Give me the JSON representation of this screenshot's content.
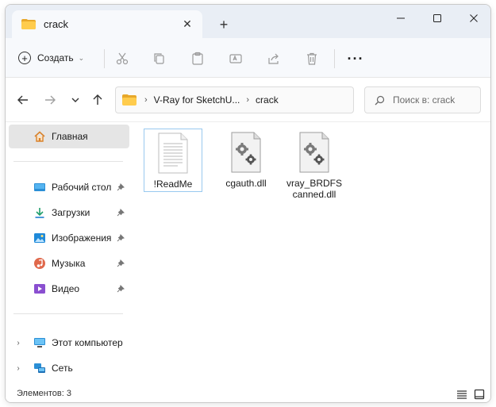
{
  "window": {
    "tab_title": "crack",
    "tab_close": "✕",
    "new_tab": "+",
    "controls": [
      "minimize-icon",
      "maximize-icon",
      "close-icon"
    ]
  },
  "toolbar": {
    "create_label": "Создать",
    "create_icon": "plus-circle-icon",
    "more_label": "···",
    "actions": [
      "cut-icon",
      "copy-icon",
      "paste-icon",
      "rename-icon",
      "share-icon",
      "delete-icon"
    ]
  },
  "address": {
    "crumbs": [
      "V-Ray for SketchU...",
      "crack"
    ],
    "search_placeholder": "Поиск в: crack"
  },
  "sidebar": {
    "home": "Главная",
    "quick_access": [
      {
        "label": "Рабочий стол",
        "icon": "desktop-icon",
        "pinned": true
      },
      {
        "label": "Загрузки",
        "icon": "downloads-icon",
        "pinned": true
      },
      {
        "label": "Изображения",
        "icon": "pictures-icon",
        "pinned": true
      },
      {
        "label": "Музыка",
        "icon": "music-icon",
        "pinned": true
      },
      {
        "label": "Видео",
        "icon": "videos-icon",
        "pinned": true
      }
    ],
    "this_pc": "Этот компьютер",
    "network": "Сеть"
  },
  "files": [
    {
      "name": "!ReadMe",
      "type": "text-document",
      "selected": true
    },
    {
      "name": "cgauth.dll",
      "type": "dll"
    },
    {
      "name": "vray_BRDFS canned.dll",
      "type": "dll"
    }
  ],
  "status": {
    "count_text": "Элементов: 3"
  },
  "colors": {
    "titlebar": "#e9eef5",
    "folder": "#ffcc4d",
    "selection": "#e5e5e5",
    "selection_border": "#99c9ef"
  }
}
